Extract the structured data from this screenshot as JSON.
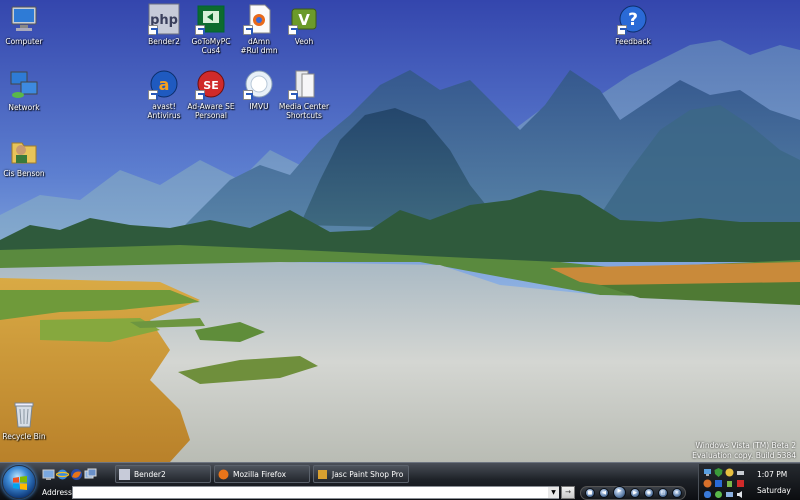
{
  "desktop": {
    "icons": [
      {
        "id": "computer",
        "label": "Computer"
      },
      {
        "id": "network",
        "label": "Network"
      },
      {
        "id": "user",
        "label": "Cis Benson"
      },
      {
        "id": "recycle",
        "label": "Recycle Bin"
      },
      {
        "id": "bender",
        "label": "Bender2"
      },
      {
        "id": "gotomypc",
        "label": "GoToMyPC\nCus4"
      },
      {
        "id": "damn",
        "label": "dAmn\n#Rul dmn"
      },
      {
        "id": "veoh",
        "label": "Veoh"
      },
      {
        "id": "avast",
        "label": "avast!\nAntivirus"
      },
      {
        "id": "adaware",
        "label": "Ad-Aware SE\nPersonal"
      },
      {
        "id": "imvu",
        "label": "IMVU"
      },
      {
        "id": "media",
        "label": "Media Center\nShortcuts"
      },
      {
        "id": "feedback",
        "label": "Feedback"
      }
    ]
  },
  "watermark": {
    "line1": "Windows Vista (TM) Beta 2",
    "line2": "Evaluation copy. Build 5384"
  },
  "taskbar": {
    "tasks": [
      {
        "label": "Bender2"
      },
      {
        "label": "Mozilla Firefox"
      },
      {
        "label": "Jasc Paint Shop Pro"
      }
    ],
    "address_label": "Address",
    "address_value": "",
    "go_label": "→",
    "clock_time": "1:07 PM",
    "clock_day": "Saturday"
  },
  "colors": {
    "sky_top": "#3a4fb0",
    "sky_bottom": "#9cc4ea",
    "water": "#cfd3d4",
    "field": "#d4a03c",
    "taskbar": "#1e2228"
  }
}
